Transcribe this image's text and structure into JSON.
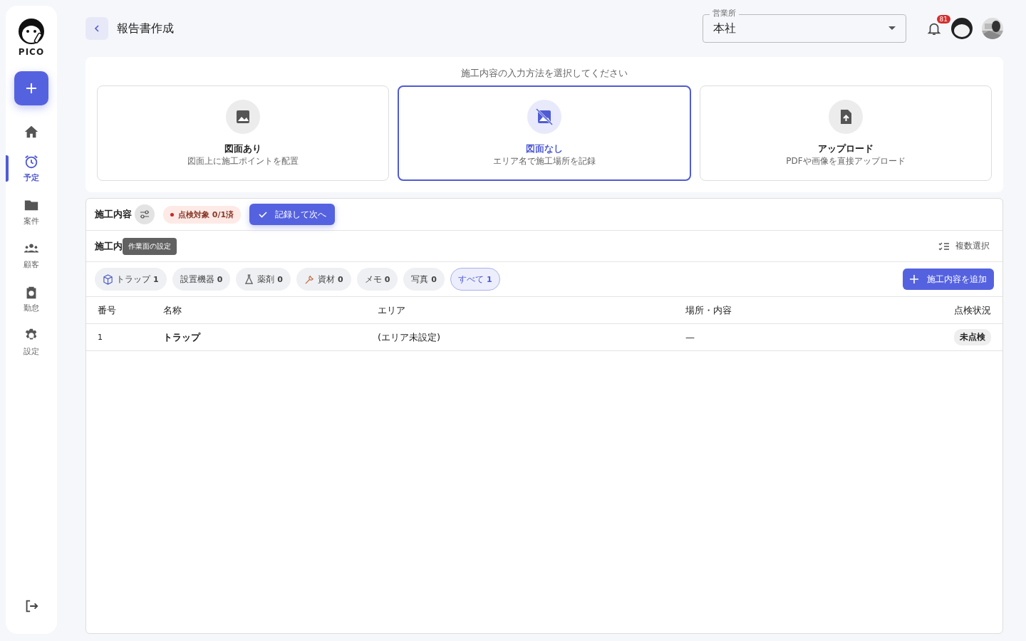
{
  "sidebar": {
    "logo": "PICO",
    "items": [
      {
        "selected": false
      },
      {
        "label": "予定",
        "selected": true
      },
      {
        "label": "案件",
        "selected": false
      },
      {
        "label": "顧客",
        "selected": false
      },
      {
        "label": "勤怠",
        "selected": false
      },
      {
        "label": "設定",
        "selected": false
      }
    ]
  },
  "header": {
    "title": "報告書作成",
    "office": {
      "label": "営業所",
      "value": "本社"
    },
    "notifications": "81"
  },
  "method": {
    "prompt": "施工内容の入力方法を選択してください",
    "options": [
      {
        "title": "図面あり",
        "desc": "図面上に施工ポイントを配置",
        "selected": false
      },
      {
        "title": "図面なし",
        "desc": "エリア名で施工場所を記録",
        "selected": true
      },
      {
        "title": "アップロード",
        "desc": "PDFや画像を直接アップロード",
        "selected": false
      }
    ]
  },
  "work": {
    "title": "施工内容",
    "status": "点検対象 0/1済",
    "record_button": "記録して次へ",
    "subtitle": "施工内",
    "tooltip": "作業面の設定",
    "multi_select": "複数選択",
    "filters": [
      {
        "label": "トラップ",
        "count": "1",
        "selected": false
      },
      {
        "label": "設置機器",
        "count": "0",
        "selected": false
      },
      {
        "label": "薬剤",
        "count": "0",
        "selected": false
      },
      {
        "label": "資材",
        "count": "0",
        "selected": false
      },
      {
        "label": "メモ",
        "count": "0",
        "selected": false
      },
      {
        "label": "写真",
        "count": "0",
        "selected": false
      },
      {
        "label": "すべて",
        "count": "1",
        "selected": true
      }
    ],
    "add_button": "施工内容を追加",
    "table": {
      "columns": [
        "番号",
        "名称",
        "エリア",
        "場所・内容",
        "点検状況"
      ],
      "rows": [
        {
          "no": "1",
          "name": "トラップ",
          "area": "(エリア未設定)",
          "place": "—",
          "status": "未点検"
        }
      ]
    }
  }
}
